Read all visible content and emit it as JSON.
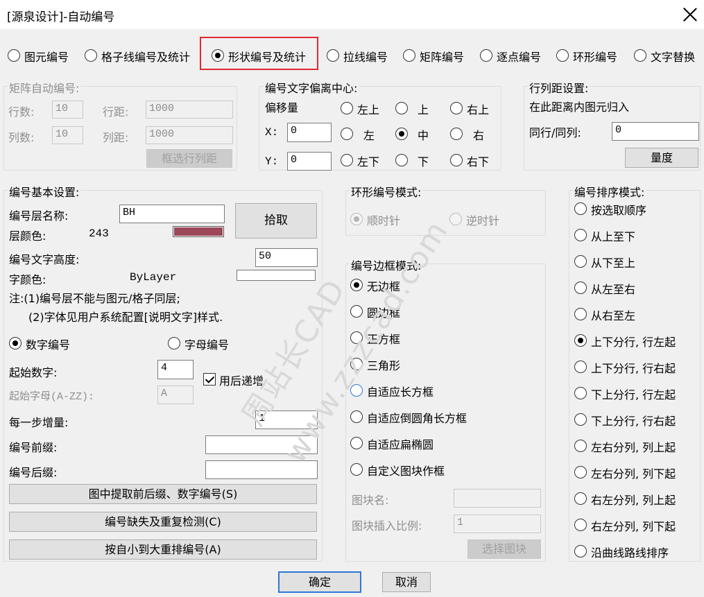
{
  "window": {
    "title": "[源泉设计]-自动编号"
  },
  "top_tabs": [
    "图元编号",
    "格子线编号及统计",
    "形状编号及统计",
    "拉线编号",
    "矩阵编号",
    "逐点编号",
    "环形编号",
    "文字替换"
  ],
  "top_tab_selected": "形状编号及统计",
  "matrix": {
    "group_label": "矩阵自动编号:",
    "rows_label": "行数:",
    "rows_value": "10",
    "row_spacing_label": "行距:",
    "row_spacing_value": "1000",
    "cols_label": "列数:",
    "cols_value": "10",
    "col_spacing_label": "列距:",
    "col_spacing_value": "1000",
    "select_button": "框选行列距"
  },
  "offset": {
    "group_label": "编号文字偏离中心:",
    "offset_label": "偏移量",
    "x_label": "X:",
    "x_value": "0",
    "y_label": "Y:",
    "y_value": "0",
    "positions": [
      "左上",
      "上",
      "右上",
      "左",
      "中",
      "右",
      "左下",
      "下",
      "右下"
    ],
    "selected": "中"
  },
  "spacing": {
    "group_label": "行列距设置:",
    "desc": "在此距离内图元归入",
    "row_col_label": "同行/同列:",
    "row_col_value": "0",
    "measure_button": "量度"
  },
  "basic": {
    "group_label": "编号基本设置:",
    "layer_name_label": "编号层名称:",
    "layer_name_value": "BH",
    "pick_button": "拾取",
    "layer_color_label": "层颜色:",
    "layer_color_value": "243",
    "layer_color_hex": "#9c4858",
    "text_height_label": "编号文字高度:",
    "text_height_value": "50",
    "font_color_label": "字颜色:",
    "font_color_value": "ByLayer",
    "note1": "注:(1)编号层不能与图元/格子同层;",
    "note2": "(2)字体见用户系统配置[说明文字]样式.",
    "numeric_label": "数字编号",
    "alpha_label": "字母编号",
    "start_num_label": "起始数字:",
    "start_num_value": "4",
    "auto_inc_label": "用后递增",
    "start_letter_label": "起始字母(A-ZZ):",
    "start_letter_value": "A",
    "step_label": "每一步增量:",
    "step_value": "1",
    "prefix_label": "编号前缀:",
    "prefix_value": "",
    "suffix_label": "编号后缀:",
    "suffix_value": "",
    "extract_button": "图中提取前后缀、数字编号(S)",
    "check_button": "编号缺失及重复检测(C)",
    "renumber_button": "按自小到大重排编号(A)"
  },
  "ring": {
    "group_label": "环形编号模式:",
    "cw_label": "顺时针",
    "ccw_label": "逆时针"
  },
  "frame": {
    "group_label": "编号边框模式:",
    "options": [
      "无边框",
      "圆边框",
      "正方框",
      "三角形",
      "自适应长方框",
      "自适应倒圆角长方框",
      "自适应扁椭圆",
      "自定义图块作框"
    ],
    "selected": "无边框",
    "block_name_label": "图块名:",
    "block_name_value": "",
    "block_scale_label": "图块插入比例:",
    "block_scale_value": "1",
    "select_block_button": "选择图块"
  },
  "sort": {
    "group_label": "编号排序模式:",
    "options": [
      "按选取顺序",
      "从上至下",
      "从下至上",
      "从左至右",
      "从右至左",
      "上下分行, 行左起",
      "上下分行, 行右起",
      "下上分行, 行左起",
      "下上分行, 行右起",
      "左右分列, 列上起",
      "左右分列, 列下起",
      "右左分列, 列上起",
      "右左分列, 列下起",
      "沿曲线路线排序"
    ],
    "selected": "上下分行, 行左起"
  },
  "footer": {
    "ok": "确定",
    "cancel": "取消"
  },
  "watermark": {
    "line1": "周站长CAD",
    "line2": "www.zzzcad.com"
  }
}
